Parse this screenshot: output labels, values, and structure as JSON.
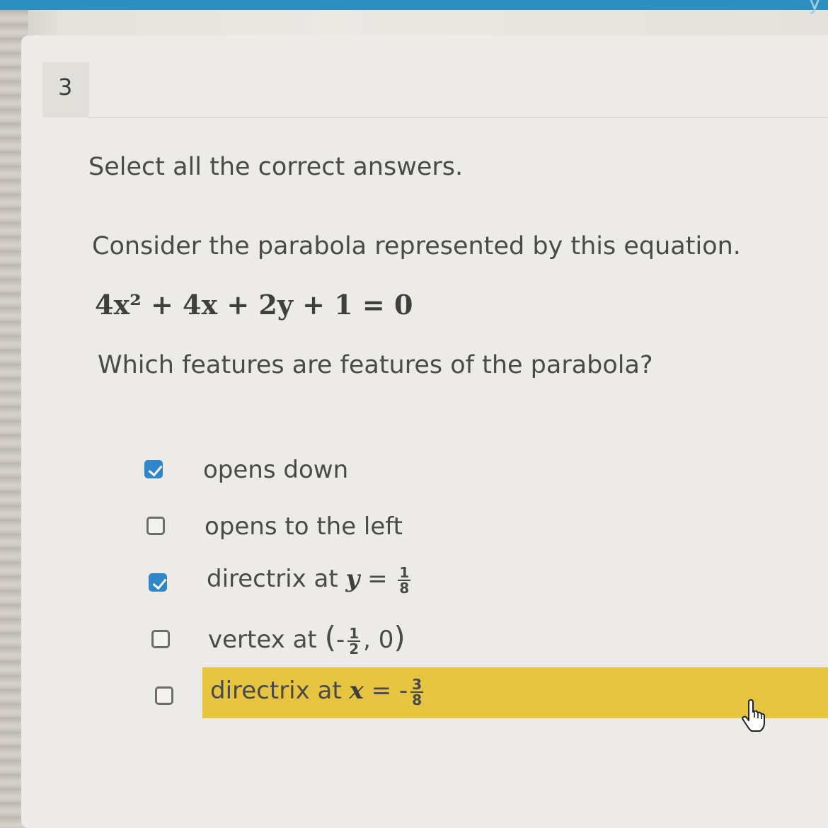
{
  "header": {
    "partial_title": "y"
  },
  "question": {
    "number": "3",
    "instructions": "Select all the correct answers.",
    "prompt": "Consider the parabola represented by this equation.",
    "equation": "4x² + 4x + 2y + 1 = 0",
    "question_text": "Which features are features of the parabola?"
  },
  "options": [
    {
      "label": "opens down",
      "checked": true
    },
    {
      "label": "opens to the left",
      "checked": false
    },
    {
      "label_prefix": "directrix at ",
      "variable": "y",
      "equals": " = ",
      "sign": "",
      "frac_num": "1",
      "frac_den": "8",
      "checked": true
    },
    {
      "label_prefix": "vertex at ",
      "sign": "-",
      "frac_num": "1",
      "frac_den": "2",
      "suffix": ", 0",
      "checked": false
    },
    {
      "label_prefix": "directrix at ",
      "variable": "x",
      "equals": " = ",
      "sign": "-",
      "frac_num": "3",
      "frac_den": "8",
      "checked": false,
      "highlighted": true
    }
  ],
  "colors": {
    "accent": "#2f86c8",
    "highlight": "#e6c43f",
    "top_bar": "#2d8fbf"
  }
}
